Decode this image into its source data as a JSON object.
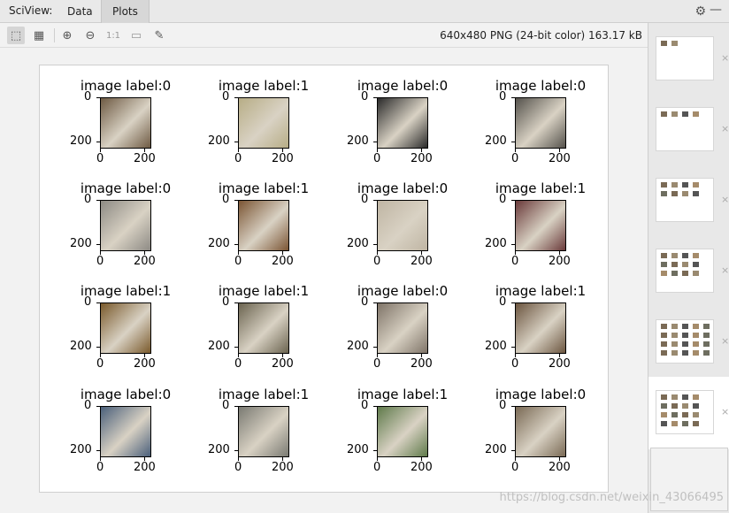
{
  "titlebar": {
    "app_label": "SciView:",
    "tabs": [
      {
        "label": "Data"
      },
      {
        "label": "Plots"
      }
    ],
    "gear_icon": "gear-icon",
    "minimize_icon": "minus-icon"
  },
  "toolbar": {
    "buttons": [
      {
        "name": "fit-to-window-button",
        "glyph": "⬚"
      },
      {
        "name": "grid-button",
        "glyph": "▦"
      },
      {
        "name": "zoom-in-button",
        "glyph": "⊕"
      },
      {
        "name": "zoom-out-button",
        "glyph": "⊖"
      },
      {
        "name": "actual-size-button",
        "glyph": "1:1"
      },
      {
        "name": "fit-zoom-button",
        "glyph": "▭"
      },
      {
        "name": "color-picker-button",
        "glyph": "✎"
      }
    ],
    "image_info": "640x480 PNG (24-bit color) 163.17 kB"
  },
  "figure": {
    "subplots": [
      {
        "title": "image label:0",
        "color": "#6e5a43"
      },
      {
        "title": "image label:1",
        "color": "#b7ad86"
      },
      {
        "title": "image label:0",
        "color": "#2a2a2a"
      },
      {
        "title": "image label:0",
        "color": "#55524c"
      },
      {
        "title": "image label:0",
        "color": "#8d8a84"
      },
      {
        "title": "image label:1",
        "color": "#7b5534"
      },
      {
        "title": "image label:0",
        "color": "#bfb5a3"
      },
      {
        "title": "image label:1",
        "color": "#6a3a3a"
      },
      {
        "title": "image label:1",
        "color": "#7a5a2c"
      },
      {
        "title": "image label:1",
        "color": "#6b6450"
      },
      {
        "title": "image label:0",
        "color": "#7f7468"
      },
      {
        "title": "image label:1",
        "color": "#6c5640"
      },
      {
        "title": "image label:0",
        "color": "#4a5f7a"
      },
      {
        "title": "image label:1",
        "color": "#7a7a72"
      },
      {
        "title": "image label:1",
        "color": "#5f7a4a"
      },
      {
        "title": "image label:0",
        "color": "#7a6a55"
      }
    ],
    "y_ticks": [
      "0",
      "200"
    ],
    "x_ticks": [
      "0",
      "200"
    ]
  },
  "thumbnails": [
    {
      "name": "thumbnail-1"
    },
    {
      "name": "thumbnail-2"
    },
    {
      "name": "thumbnail-3"
    },
    {
      "name": "thumbnail-4"
    },
    {
      "name": "thumbnail-5"
    },
    {
      "name": "thumbnail-6"
    }
  ],
  "watermark": "https://blog.csdn.net/weixin_43066495"
}
